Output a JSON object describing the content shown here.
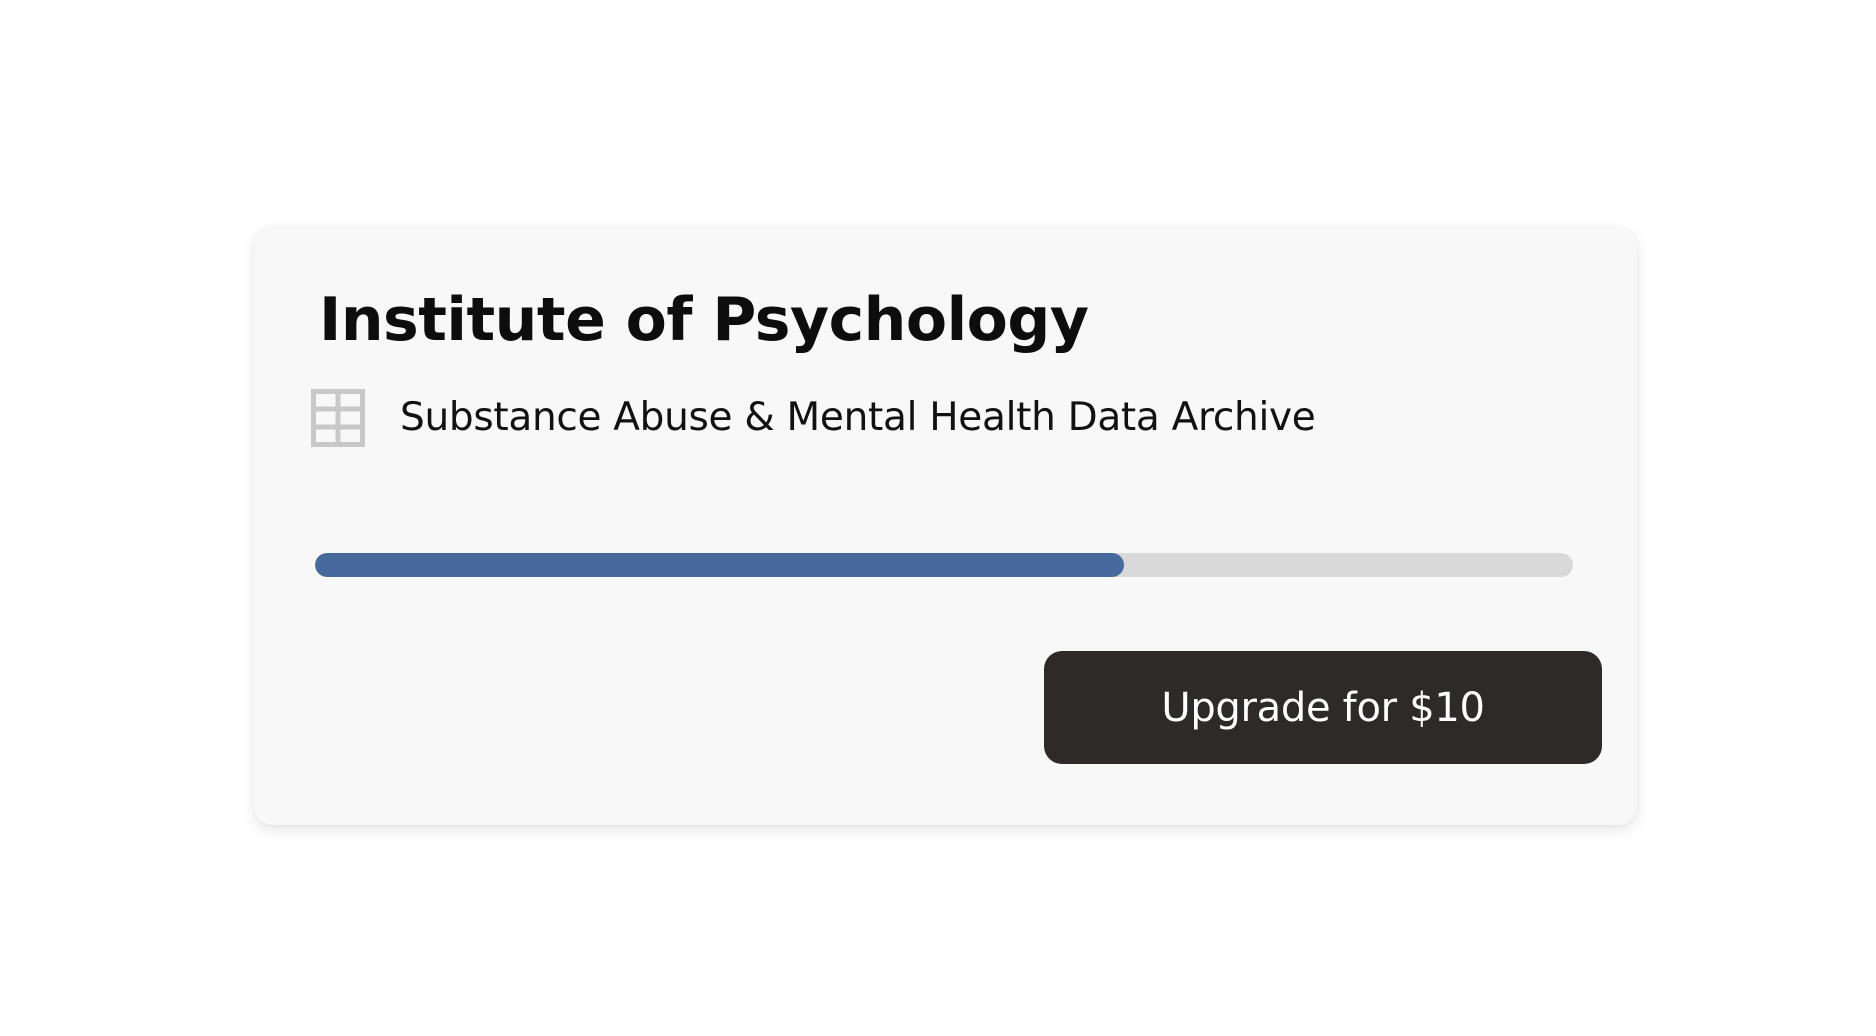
{
  "card": {
    "title": "Institute of Psychology",
    "source": {
      "icon": "table-grid-icon",
      "label": "Substance Abuse & Mental Health Data Archive"
    },
    "progress": {
      "fraction": 0.643,
      "fill_color": "#48699c",
      "track_color": "#d9d9d9"
    },
    "upgrade_button": {
      "label": "Upgrade for $10",
      "background": "#2e2a2a"
    }
  }
}
